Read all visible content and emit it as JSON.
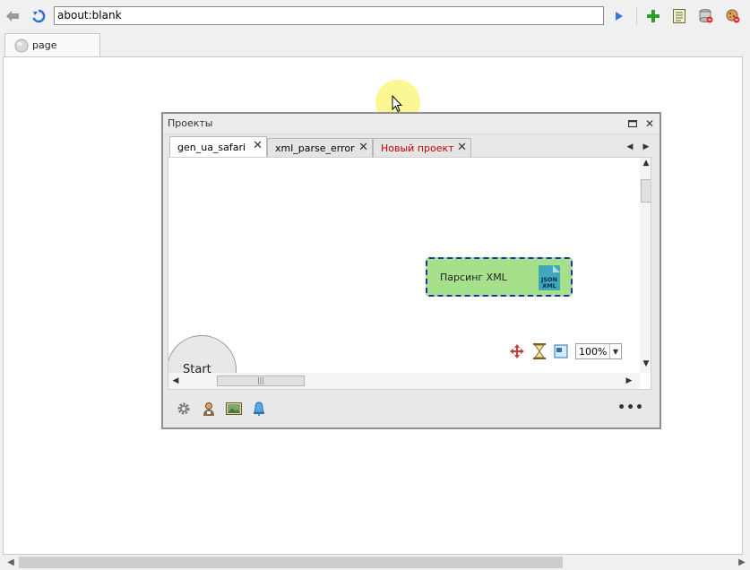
{
  "toolbar": {
    "address": "about:blank",
    "icons": [
      "back-arrow-icon",
      "refresh-icon",
      "go-icon",
      "add-tab-icon",
      "page-source-icon",
      "clear-cache-icon",
      "cookies-icon"
    ]
  },
  "tabs": [
    {
      "label": "page",
      "active": true
    }
  ],
  "panel": {
    "title": "Проекты",
    "tabs": [
      {
        "label": "gen_ua_safari",
        "active": true,
        "color": "#000000"
      },
      {
        "label": "xml_parse_error",
        "active": false,
        "color": "#000000"
      },
      {
        "label": "Новый проект",
        "active": false,
        "color": "#c00000"
      }
    ],
    "node": {
      "label": "Парсинг XML",
      "icon_text_1": "JSON",
      "icon_text_2": "XML",
      "fill": "#a6e08a",
      "border": "#1c2fbf"
    },
    "start_label": "Start",
    "zoom": "100%",
    "footer_more": "•••"
  },
  "colors": {
    "accent_green": "#2e9e2e",
    "accent_blue": "#2a6fd6",
    "new_project_red": "#c00000"
  }
}
